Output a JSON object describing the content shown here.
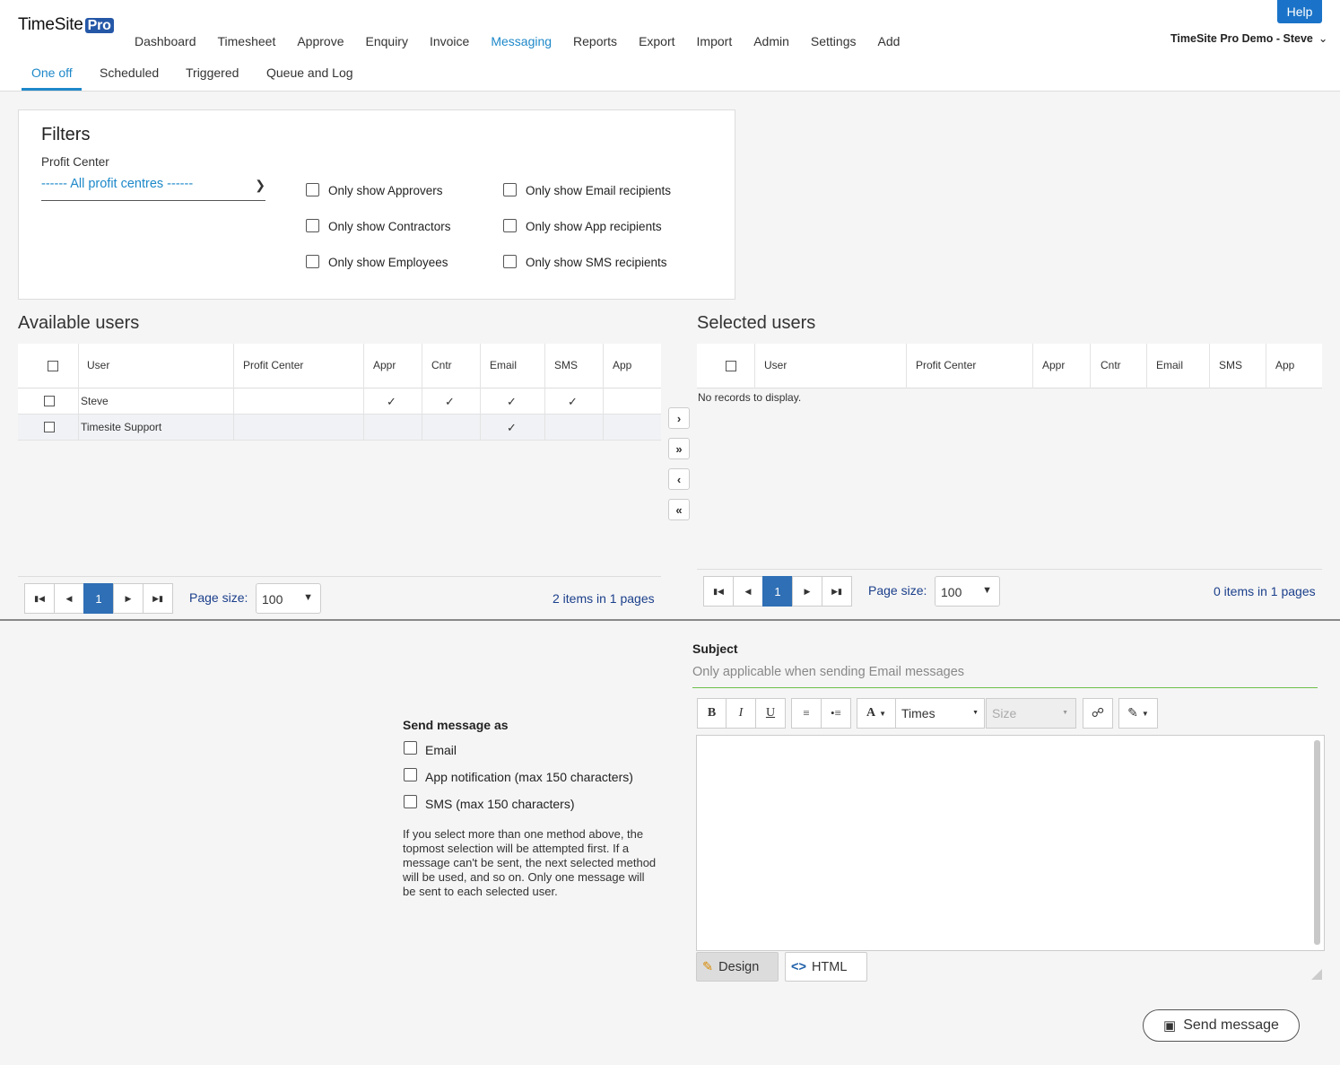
{
  "header": {
    "logo_text": "TimeSite",
    "logo_badge": "Pro",
    "help_label": "Help",
    "account_label": "TimeSite Pro Demo - Steve",
    "nav": [
      "Dashboard",
      "Timesheet",
      "Approve",
      "Enquiry",
      "Invoice",
      "Messaging",
      "Reports",
      "Export",
      "Import",
      "Admin",
      "Settings",
      "Add"
    ],
    "active_nav": "Messaging"
  },
  "subtabs": [
    "One off",
    "Scheduled",
    "Triggered",
    "Queue and Log"
  ],
  "filters": {
    "title": "Filters",
    "profit_center_label": "Profit Center",
    "profit_center_value": "------ All profit centres ------",
    "checkboxes": {
      "approvers": "Only show Approvers",
      "contractors": "Only show Contractors",
      "employees": "Only show Employees",
      "email": "Only show Email recipients",
      "app": "Only show App recipients",
      "sms": "Only show SMS recipients"
    }
  },
  "available": {
    "title": "Available users",
    "columns": [
      "User",
      "Profit Center",
      "Appr",
      "Cntr",
      "Email",
      "SMS",
      "App"
    ],
    "rows": [
      {
        "user": "Steve",
        "profit_center": "",
        "appr": "✓",
        "cntr": "✓",
        "email": "✓",
        "sms": "✓",
        "app": ""
      },
      {
        "user": "Timesite Support",
        "profit_center": "",
        "appr": "",
        "cntr": "",
        "email": "✓",
        "sms": "",
        "app": ""
      }
    ],
    "pager": {
      "page": "1",
      "page_size_label": "Page size:",
      "page_size": "100",
      "info": "2 items in 1 pages"
    }
  },
  "selected": {
    "title": "Selected users",
    "columns": [
      "User",
      "Profit Center",
      "Appr",
      "Cntr",
      "Email",
      "SMS",
      "App"
    ],
    "empty_text": "No records to display.",
    "pager": {
      "page": "1",
      "page_size_label": "Page size:",
      "page_size": "100",
      "info": "0 items in 1 pages"
    }
  },
  "send_as": {
    "title": "Send message as",
    "options": {
      "email": "Email",
      "app": "App notification (max 150 characters)",
      "sms": "SMS (max 150 characters)"
    },
    "note": "If you select more than one method above, the topmost selection will be attempted first. If a message can't be sent, the next selected method will be used, and so on. Only one message will be sent to each selected user."
  },
  "message": {
    "subject_label": "Subject",
    "subject_placeholder": "Only applicable when sending Email messages",
    "font_name": "Times",
    "font_size_placeholder": "Size",
    "design_label": "Design",
    "html_label": "HTML",
    "send_label": "Send message"
  },
  "colors": {
    "accent": "#1e88c9",
    "pager_active": "#2f6fb5",
    "subject_underline": "#6cbf4a"
  }
}
